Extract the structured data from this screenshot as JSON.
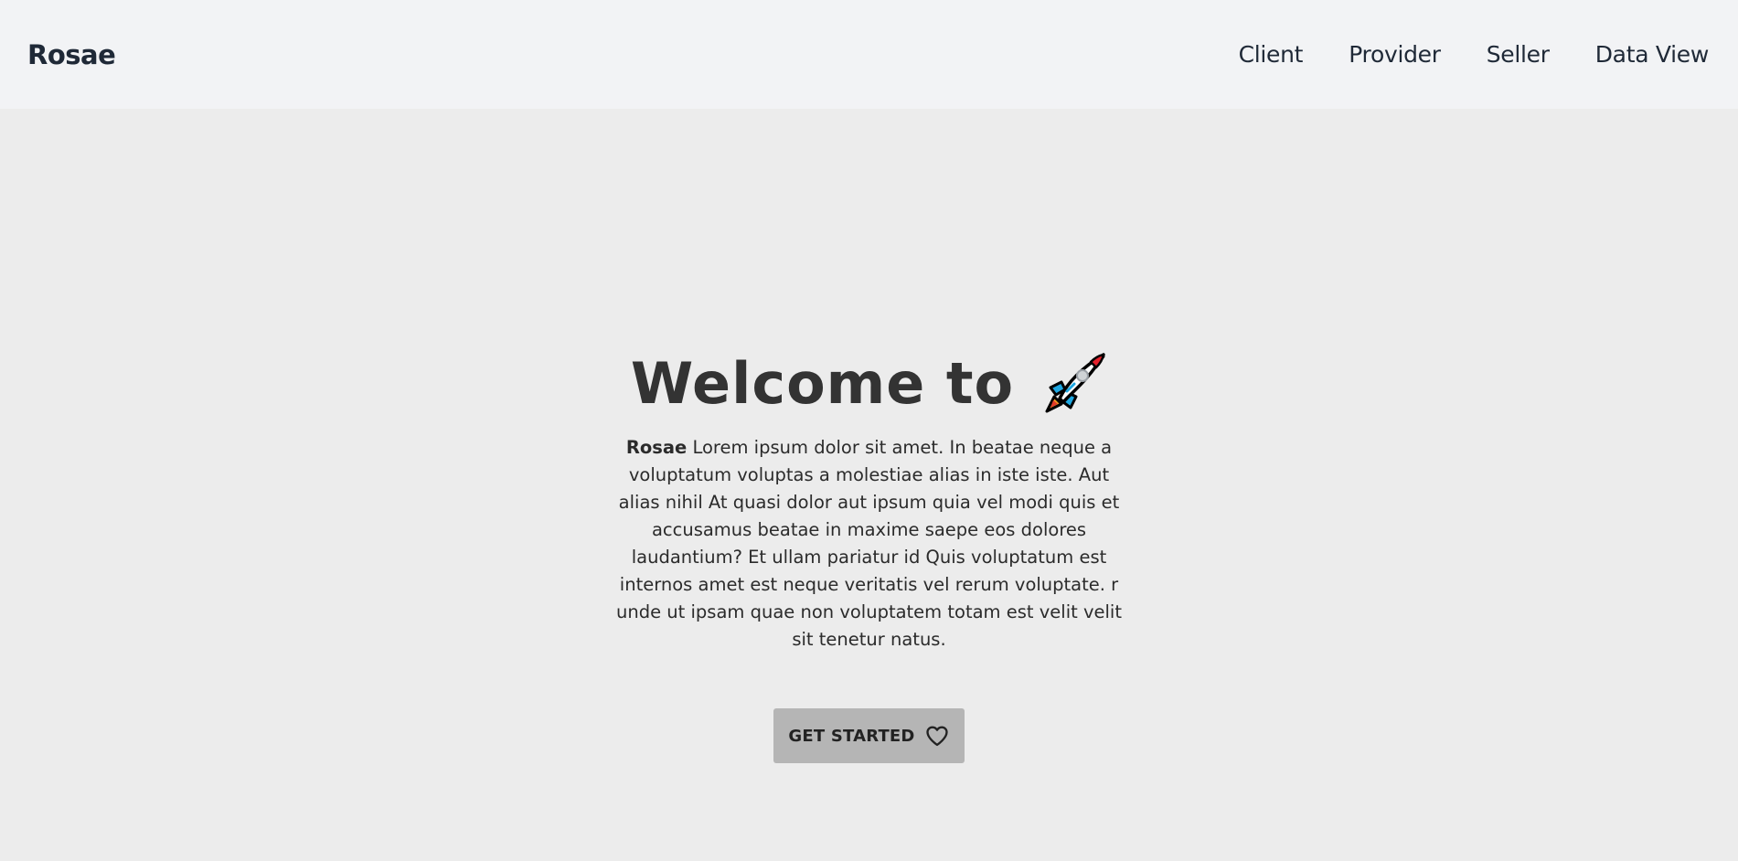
{
  "navbar": {
    "brand": "Rosae",
    "links": [
      "Client",
      "Provider",
      "Seller",
      "Data View"
    ]
  },
  "hero": {
    "title": "Welcome to",
    "title_icon": "rocket-icon",
    "brand_inline": "Rosae",
    "description": "Lorem ipsum dolor sit amet. In beatae neque a voluptatum voluptas a molestiae alias in iste iste. Aut alias nihil At quasi dolor aut ipsum quia vel modi quis et accusamus beatae in maxime saepe eos dolores laudantium? Et ullam pariatur id Quis voluptatum est internos amet est neque veritatis vel rerum voluptate. r unde ut ipsam quae non voluptatem totam est velit velit sit tenetur natus.",
    "cta_label": "GET STARTED",
    "cta_icon": "heart-icon"
  },
  "colors": {
    "navbar_bg": "#f2f3f5",
    "page_bg": "#ececec",
    "button_bg": "#b5b5b5",
    "text": "#2b2b2b"
  }
}
